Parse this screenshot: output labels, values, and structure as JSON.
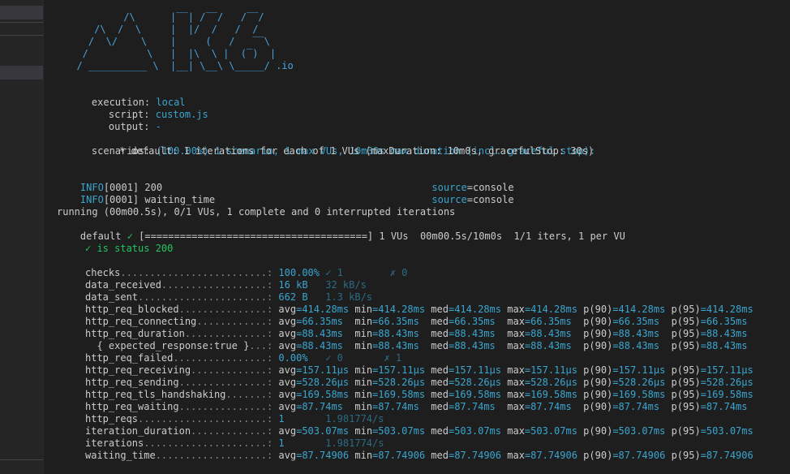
{
  "logo": {
    "lines": [
      "          /\\      |‾‾| /‾‾/   /‾‾/",
      "     /\\  /  \\     |  |/  /   /  /",
      "    /  \\/    \\    |     (   /   ‾‾\\",
      "   /          \\   |  |\\  \\ |  (‾)  |",
      "  / __________ \\  |__| \\__\\ \\_____/ .io"
    ]
  },
  "execution": {
    "execution_label": "execution:",
    "execution_value": "local",
    "script_label": "script:",
    "script_value": "custom.js",
    "output_label": "output:",
    "output_value": "-"
  },
  "scenarios": {
    "label": "scenarios:",
    "summary": "(100.00%) 1 scenario, 1 max VUs, 10m30s max duration (incl. graceful stop):",
    "detail": "* default: 1 iterations for each of 1 VUs (maxDuration: 10m0s, gracefulStop: 30s)"
  },
  "logs": [
    {
      "prefix": "INFO",
      "text": "[0001] 200                                              ",
      "source_key": "source",
      "source_val": "=console"
    },
    {
      "prefix": "INFO",
      "text": "[0001] waiting_time                                     ",
      "source_key": "source",
      "source_val": "=console"
    }
  ],
  "progress": {
    "running": "running (00m00.5s), 0/1 VUs, 1 complete and 0 interrupted iterations",
    "default_label": "default ",
    "check": "✓",
    "bar": " [======================================] 1 VUs  00m00.5s/10m0s  1/1 iters, 1 per VU"
  },
  "check_result": "✓ is status 200",
  "metrics": [
    {
      "name": "checks",
      "dots": ".........................:",
      "main": " 100.00%",
      "dim": " ✓ 1        ✗ 0"
    },
    {
      "name": "data_received",
      "dots": "..................:",
      "main": " 16 kB ",
      "dim": "  32 kB/s"
    },
    {
      "name": "data_sent",
      "dots": "......................:",
      "main": " 662 B ",
      "dim": "  1.3 kB/s"
    },
    {
      "name": "http_req_blocked",
      "dots": "...............:",
      "stats": [
        [
          "avg",
          "=414.28ms"
        ],
        [
          "min",
          "=414.28ms"
        ],
        [
          "med",
          "=414.28ms"
        ],
        [
          "max",
          "=414.28ms"
        ],
        [
          "p(90)",
          "=414.28ms"
        ],
        [
          "p(95)",
          "=414.28ms"
        ]
      ]
    },
    {
      "name": "http_req_connecting",
      "dots": "............:",
      "stats": [
        [
          "avg",
          "=66.35ms "
        ],
        [
          "min",
          "=66.35ms "
        ],
        [
          "med",
          "=66.35ms "
        ],
        [
          "max",
          "=66.35ms "
        ],
        [
          "p(90)",
          "=66.35ms "
        ],
        [
          "p(95)",
          "=66.35ms"
        ]
      ]
    },
    {
      "name": "http_req_duration",
      "dots": "..............:",
      "stats": [
        [
          "avg",
          "=88.43ms "
        ],
        [
          "min",
          "=88.43ms "
        ],
        [
          "med",
          "=88.43ms "
        ],
        [
          "max",
          "=88.43ms "
        ],
        [
          "p(90)",
          "=88.43ms "
        ],
        [
          "p(95)",
          "=88.43ms"
        ]
      ]
    },
    {
      "name": "  { expected_response:true }",
      "dots": "...:",
      "stats": [
        [
          "avg",
          "=88.43ms "
        ],
        [
          "min",
          "=88.43ms "
        ],
        [
          "med",
          "=88.43ms "
        ],
        [
          "max",
          "=88.43ms "
        ],
        [
          "p(90)",
          "=88.43ms "
        ],
        [
          "p(95)",
          "=88.43ms"
        ]
      ]
    },
    {
      "name": "http_req_failed",
      "dots": "................:",
      "main": " 0.00% ",
      "dim": "  ✓ 0       ✗ 1"
    },
    {
      "name": "http_req_receiving",
      "dots": ".............:",
      "stats": [
        [
          "avg",
          "=157.11µs"
        ],
        [
          "min",
          "=157.11µs"
        ],
        [
          "med",
          "=157.11µs"
        ],
        [
          "max",
          "=157.11µs"
        ],
        [
          "p(90)",
          "=157.11µs"
        ],
        [
          "p(95)",
          "=157.11µs"
        ]
      ]
    },
    {
      "name": "http_req_sending",
      "dots": "...............:",
      "stats": [
        [
          "avg",
          "=528.26µs"
        ],
        [
          "min",
          "=528.26µs"
        ],
        [
          "med",
          "=528.26µs"
        ],
        [
          "max",
          "=528.26µs"
        ],
        [
          "p(90)",
          "=528.26µs"
        ],
        [
          "p(95)",
          "=528.26µs"
        ]
      ]
    },
    {
      "name": "http_req_tls_handshaking",
      "dots": ".......:",
      "stats": [
        [
          "avg",
          "=169.58ms"
        ],
        [
          "min",
          "=169.58ms"
        ],
        [
          "med",
          "=169.58ms"
        ],
        [
          "max",
          "=169.58ms"
        ],
        [
          "p(90)",
          "=169.58ms"
        ],
        [
          "p(95)",
          "=169.58ms"
        ]
      ]
    },
    {
      "name": "http_req_waiting",
      "dots": "...............:",
      "stats": [
        [
          "avg",
          "=87.74ms "
        ],
        [
          "min",
          "=87.74ms "
        ],
        [
          "med",
          "=87.74ms "
        ],
        [
          "max",
          "=87.74ms "
        ],
        [
          "p(90)",
          "=87.74ms "
        ],
        [
          "p(95)",
          "=87.74ms"
        ]
      ]
    },
    {
      "name": "http_reqs",
      "dots": "......................:",
      "main": " 1      ",
      "dim": " 1.981774/s"
    },
    {
      "name": "iteration_duration",
      "dots": ".............:",
      "stats": [
        [
          "avg",
          "=503.07ms"
        ],
        [
          "min",
          "=503.07ms"
        ],
        [
          "med",
          "=503.07ms"
        ],
        [
          "max",
          "=503.07ms"
        ],
        [
          "p(90)",
          "=503.07ms"
        ],
        [
          "p(95)",
          "=503.07ms"
        ]
      ]
    },
    {
      "name": "iterations",
      "dots": ".....................:",
      "main": " 1      ",
      "dim": " 1.981774/s"
    },
    {
      "name": "waiting_time",
      "dots": "...................:",
      "stats": [
        [
          "avg",
          "=87.74906"
        ],
        [
          "min",
          "=87.74906"
        ],
        [
          "med",
          "=87.74906"
        ],
        [
          "max",
          "=87.74906"
        ],
        [
          "p(90)",
          "=87.74906"
        ],
        [
          "p(95)",
          "=87.74906"
        ]
      ]
    }
  ]
}
